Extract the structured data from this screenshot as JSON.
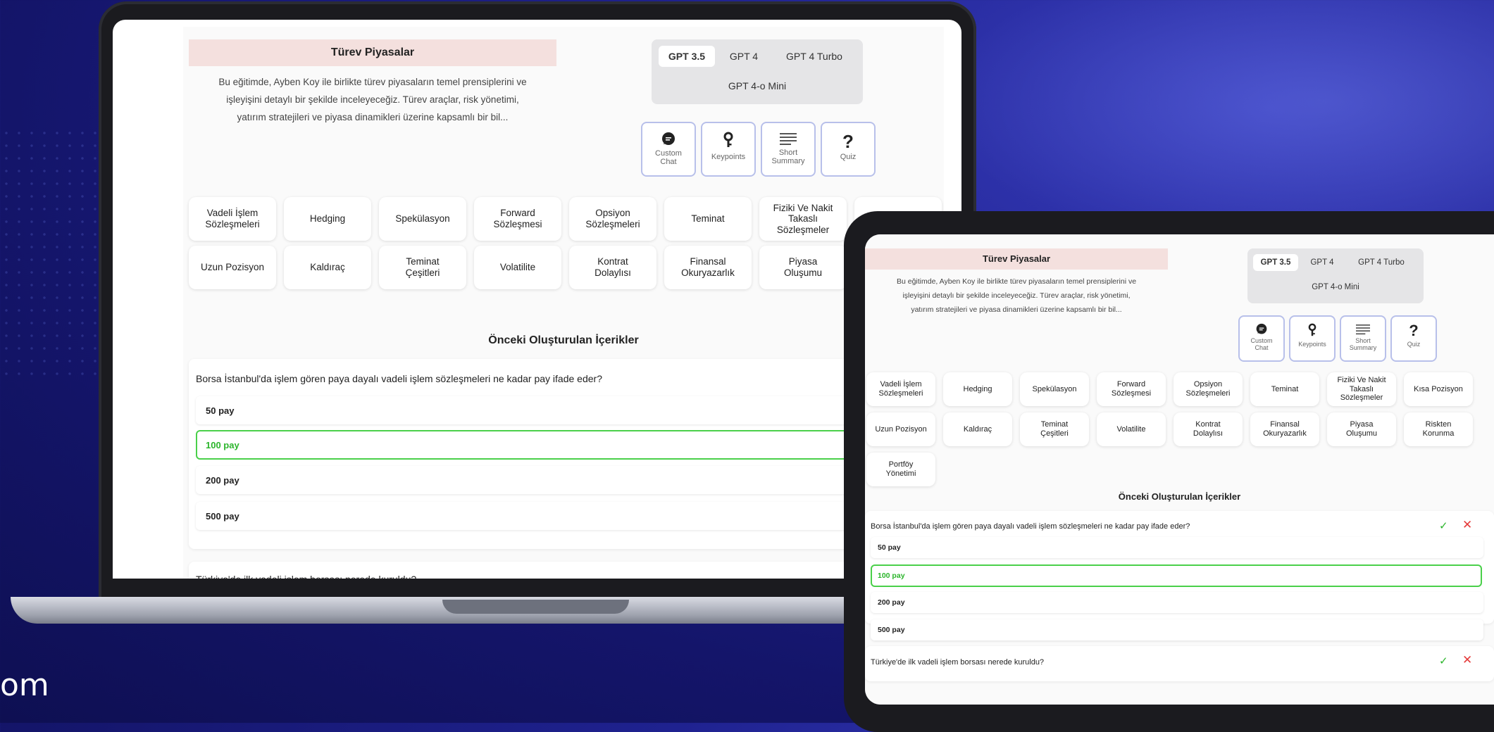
{
  "corner_text": "om",
  "course": {
    "title": "Türev Piyasalar",
    "description_lines": [
      "Bu eğitimde, Ayben Koy ile birlikte türev piyasaların temel prensiplerini ve",
      "işleyişini detaylı bir şekilde inceleyeceğiz. Türev araçlar, risk yönetimi,",
      "yatırım stratejileri ve piyasa dinamikleri üzerine kapsamlı bir bil..."
    ]
  },
  "models": {
    "tabs": [
      "GPT 3.5",
      "GPT 4",
      "GPT 4 Turbo",
      "GPT 4-o Mini"
    ],
    "active": "GPT 3.5"
  },
  "tools": [
    {
      "label_lines": [
        "Custom",
        "Chat"
      ],
      "icon": "chat-bubble-icon"
    },
    {
      "label_lines": [
        "Keypoints"
      ],
      "icon": "key-icon"
    },
    {
      "label_lines": [
        "Short",
        "Summary"
      ],
      "icon": "lines-icon"
    },
    {
      "label_lines": [
        "Quiz"
      ],
      "icon": "question-icon"
    }
  ],
  "topics_laptop": [
    [
      "Vadeli İşlem",
      "Sözleşmeleri"
    ],
    [
      "Hedging"
    ],
    [
      "Spekülasyon"
    ],
    [
      "Forward",
      "Sözleşmesi"
    ],
    [
      "Opsiyon",
      "Sözleşmeleri"
    ],
    [
      "Teminat"
    ],
    [
      "Fiziki Ve Nakit",
      "Takaslı",
      "Sözleşmeler"
    ],
    [
      "Kısa Pozisyon"
    ],
    [
      "Uzun Pozisyon"
    ],
    [
      "Kaldıraç"
    ],
    [
      "Teminat",
      "Çeşitleri"
    ],
    [
      "Volatilite"
    ],
    [
      "Kontrat",
      "Dolaylısı"
    ],
    [
      "Finansal",
      "Okuryazarlık"
    ],
    [
      "Piyasa",
      "Oluşumu"
    ],
    [
      "Portföy",
      "Yönetimi"
    ]
  ],
  "topics_tablet": [
    [
      "Vadeli İşlem",
      "Sözleşmeleri"
    ],
    [
      "Hedging"
    ],
    [
      "Spekülasyon"
    ],
    [
      "Forward",
      "Sözleşmesi"
    ],
    [
      "Opsiyon",
      "Sözleşmeleri"
    ],
    [
      "Teminat"
    ],
    [
      "Fiziki Ve Nakit",
      "Takaslı",
      "Sözleşmeler"
    ],
    [
      "Kısa Pozisyon"
    ],
    [
      "Uzun Pozisyon"
    ],
    [
      "Kaldıraç"
    ],
    [
      "Teminat",
      "Çeşitleri"
    ],
    [
      "Volatilite"
    ],
    [
      "Kontrat",
      "Dolaylısı"
    ],
    [
      "Finansal",
      "Okuryazarlık"
    ],
    [
      "Piyasa",
      "Oluşumu"
    ],
    [
      "Riskten",
      "Korunma"
    ],
    [
      "Portföy",
      "Yönetimi"
    ]
  ],
  "previous": {
    "title": "Önceki Oluşturulan İçerikler",
    "q1": "Borsa İstanbul'da işlem gören paya dayalı vadeli işlem sözleşmeleri ne kadar pay ifade eder?",
    "options": [
      "50 pay",
      "100 pay",
      "200 pay",
      "500 pay"
    ],
    "correct_index": 1,
    "q2": "Türkiye'de ilk vadeli işlem borsası nerede kuruldu?"
  },
  "colors": {
    "correct": "#2bb52b",
    "wrong": "#e53b3b",
    "title_bg": "#f4e0de",
    "tool_border": "#b8c0ea",
    "background": "#14156a"
  }
}
